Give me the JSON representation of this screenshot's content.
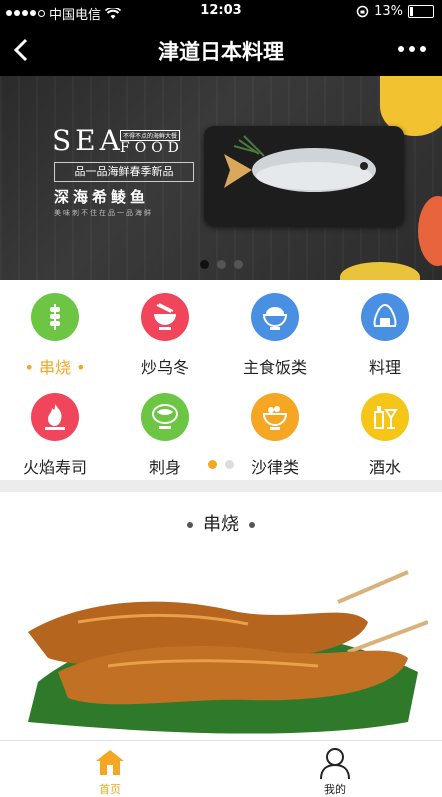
{
  "status_bar": {
    "carrier": "中国电信",
    "time": "12:03",
    "battery": "13%"
  },
  "nav": {
    "title": "津道日本料理"
  },
  "banner": {
    "sea_text": "SEA",
    "food_text": "FOOD",
    "tag": "不得不点的海鲜大餐",
    "subtitle": "品一品海鲜春季新品",
    "headline": "深海希鲮鱼",
    "tagline": "美味刺不住在品一品海鲜",
    "slide_count": 3,
    "active_slide": 0
  },
  "categories": [
    {
      "label": "串烧",
      "icon": "skewer-icon",
      "color": "#6cc644",
      "active": true
    },
    {
      "label": "炒乌冬",
      "icon": "noodle-bowl-icon",
      "color": "#f0455a",
      "active": false
    },
    {
      "label": "主食饭类",
      "icon": "rice-bowl-icon",
      "color": "#4a90e2",
      "active": false
    },
    {
      "label": "料理",
      "icon": "onigiri-icon",
      "color": "#4a90e2",
      "active": false
    },
    {
      "label": "火焰寿司",
      "icon": "flame-icon",
      "color": "#f0455a",
      "active": false
    },
    {
      "label": "刺身",
      "icon": "sashimi-icon",
      "color": "#6cc644",
      "active": false
    },
    {
      "label": "沙律类",
      "icon": "salad-bowl-icon",
      "color": "#f5a623",
      "active": false
    },
    {
      "label": "酒水",
      "icon": "drinks-icon",
      "color": "#f5c518",
      "active": false
    }
  ],
  "category_pages": 2,
  "active_category_page": 0,
  "section": {
    "title": "串烧"
  },
  "tabbar": {
    "home_label": "首页",
    "mine_label": "我的",
    "accent": "#f5a623"
  }
}
